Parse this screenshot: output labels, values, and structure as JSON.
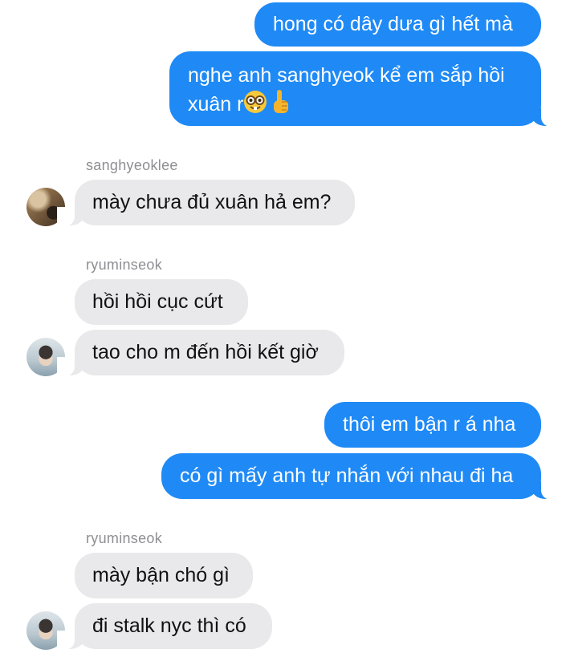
{
  "messages": {
    "out1": "hong có dây dưa gì hết mà",
    "out2_line1": "nghe anh sanghyeok kể em sắp hồi",
    "out2_line2": "xuân r",
    "out2_emojis": [
      "nerd-face-emoji",
      "index-pointing-up-emoji"
    ],
    "sender1": "sanghyeoklee",
    "in1": "mày chưa đủ xuân hả em?",
    "sender2": "ryuminseok",
    "in2": "hồi hồi cục cứt",
    "in3": "tao cho m đến hồi kết giờ",
    "out3": "thôi em bận r á nha",
    "out4": "có gì mấy anh tự nhắn với nhau đi ha",
    "sender3": "ryuminseok",
    "in4": "mày bận chó gì",
    "in5": "đi stalk nyc thì có"
  },
  "colors": {
    "outgoing_bubble": "#1f8af6",
    "incoming_bubble": "#e9e9eb",
    "sender_name": "#8e8e93"
  }
}
